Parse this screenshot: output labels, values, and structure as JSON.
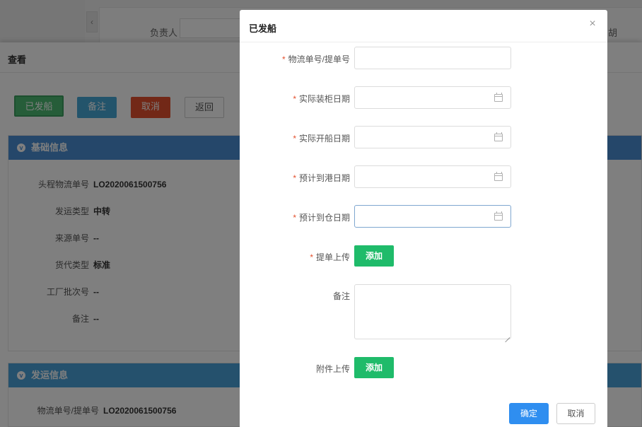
{
  "background": {
    "header_owner_label": "负责人",
    "header_right_label": "胡",
    "collapse_chevron": "‹",
    "view_title": "查看",
    "buttons": {
      "shipped": "已发船",
      "remark": "备注",
      "cancel": "取消",
      "back": "返回"
    },
    "basic_info": {
      "title": "基础信息",
      "rows": [
        {
          "label": "头程物流单号",
          "value": "LO2020061500756"
        },
        {
          "label": "发运类型",
          "value": "中转"
        },
        {
          "label": "来源单号",
          "value": "--"
        },
        {
          "label": "货代类型",
          "value": "标准"
        },
        {
          "label": "工厂批次号",
          "value": "--"
        },
        {
          "label": "备注",
          "value": "--"
        }
      ]
    },
    "shipping_info": {
      "title": "发运信息",
      "rows": [
        {
          "label": "物流单号/提单号",
          "value": "LO2020061500756"
        }
      ]
    }
  },
  "modal": {
    "title": "已发船",
    "close_glyph": "×",
    "required_mark": "*",
    "fields": {
      "tracking_no": {
        "label": "物流单号/提单号",
        "value": "",
        "placeholder": ""
      },
      "loading_date": {
        "label": "实际装柜日期",
        "value": ""
      },
      "sailing_date": {
        "label": "实际开船日期",
        "value": ""
      },
      "arrival_date": {
        "label": "预计到港日期",
        "value": ""
      },
      "warehouse_date": {
        "label": "预计到仓日期",
        "value": ""
      },
      "bill_upload": {
        "label": "提单上传",
        "button": "添加"
      },
      "remark": {
        "label": "备注",
        "value": ""
      },
      "attachment_upload": {
        "label": "附件上传",
        "button": "添加"
      }
    },
    "footer": {
      "ok": "确定",
      "cancel": "取消"
    }
  }
}
